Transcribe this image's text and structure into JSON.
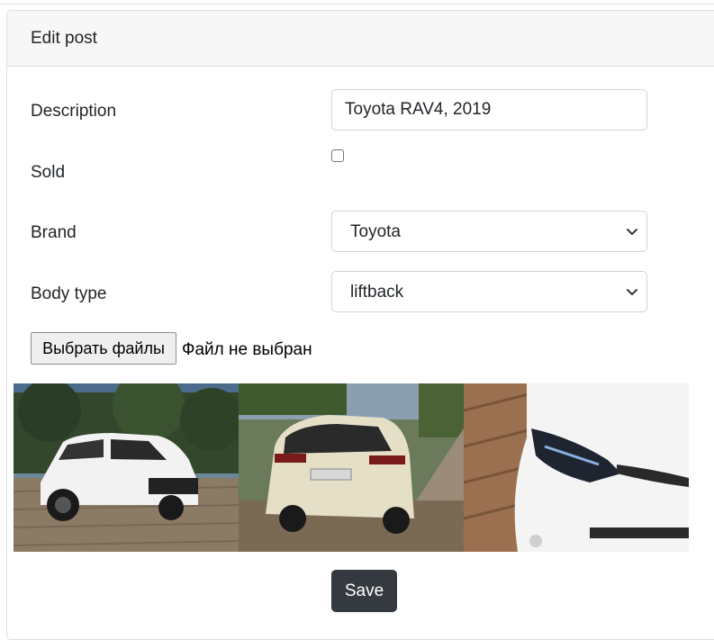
{
  "header": {
    "title": "Edit post"
  },
  "form": {
    "description": {
      "label": "Description",
      "value": "Toyota RAV4, 2019"
    },
    "sold": {
      "label": "Sold",
      "checked": false
    },
    "brand": {
      "label": "Brand",
      "value": "Toyota"
    },
    "body_type": {
      "label": "Body type",
      "value": "liftback"
    },
    "file": {
      "button_label": "Выбрать файлы",
      "status": "Файл не выбран"
    },
    "photos": [
      {
        "name": "white-suv-front-three-quarter"
      },
      {
        "name": "white-suv-rear"
      },
      {
        "name": "white-suv-headlight-closeup"
      }
    ],
    "save_label": "Save"
  },
  "colors": {
    "save_button": "#343a40",
    "header_bg": "#f7f7f7",
    "border": "#ced4da"
  }
}
